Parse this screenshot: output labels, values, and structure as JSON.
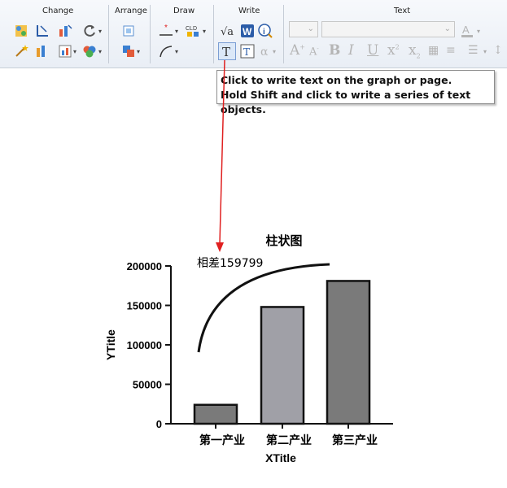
{
  "ribbon": {
    "groups": {
      "change": "Change",
      "arrange": "Arrange",
      "draw": "Draw",
      "write": "Write",
      "text": "Text"
    }
  },
  "tooltip": {
    "line1": "Click to write text on the graph or page.",
    "line2": "Hold Shift and click to write a series of text objects."
  },
  "colors": {
    "arrow": "#e02020",
    "bar_dark": "#7a7a7a",
    "bar_light": "#a0a0a7"
  },
  "chart_data": {
    "type": "bar",
    "title": "柱状图",
    "xlabel": "XTitle",
    "ylabel": "YTitle",
    "categories": [
      "第一产业",
      "第二产业",
      "第三产业"
    ],
    "values": [
      24000,
      148000,
      181000
    ],
    "ylim": [
      0,
      200000
    ],
    "yticks": [
      0,
      50000,
      100000,
      150000,
      200000
    ],
    "annotation": "相差159799"
  }
}
